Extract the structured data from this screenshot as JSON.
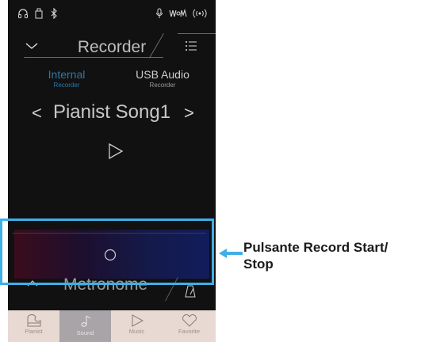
{
  "statusbar": {
    "icons": [
      "headphones-icon",
      "usb-memory-icon",
      "bluetooth-icon",
      "microphone-icon",
      "vmom-logo-icon",
      "wireless-icon"
    ]
  },
  "header": {
    "title": "Recorder",
    "back_icon": "chevron-down-icon",
    "menu_icon": "list-menu-icon"
  },
  "tabs": [
    {
      "label": "Internal",
      "sublabel": "Recorder",
      "active": true
    },
    {
      "label": "USB Audio",
      "sublabel": "Recorder",
      "active": false
    }
  ],
  "song": {
    "name": "Pianist Song1",
    "prev": "<",
    "next": ">"
  },
  "record": {
    "icon": "record-start-stop-icon"
  },
  "metronome": {
    "label": "Metronome"
  },
  "tabbar": [
    {
      "label": "Pianist",
      "icon": "piano-icon",
      "active": false
    },
    {
      "label": "Sound",
      "icon": "music-note-icon",
      "active": true
    },
    {
      "label": "Music",
      "icon": "play-icon",
      "active": false
    },
    {
      "label": "Favorite",
      "icon": "heart-icon",
      "active": false
    }
  ],
  "callout": {
    "text": "Pulsante Record Start/ Stop"
  },
  "colors": {
    "highlight": "#3fb0e6",
    "active_tab_text": "#2c78a8",
    "tabbar_bg": "#e8d9d2"
  }
}
